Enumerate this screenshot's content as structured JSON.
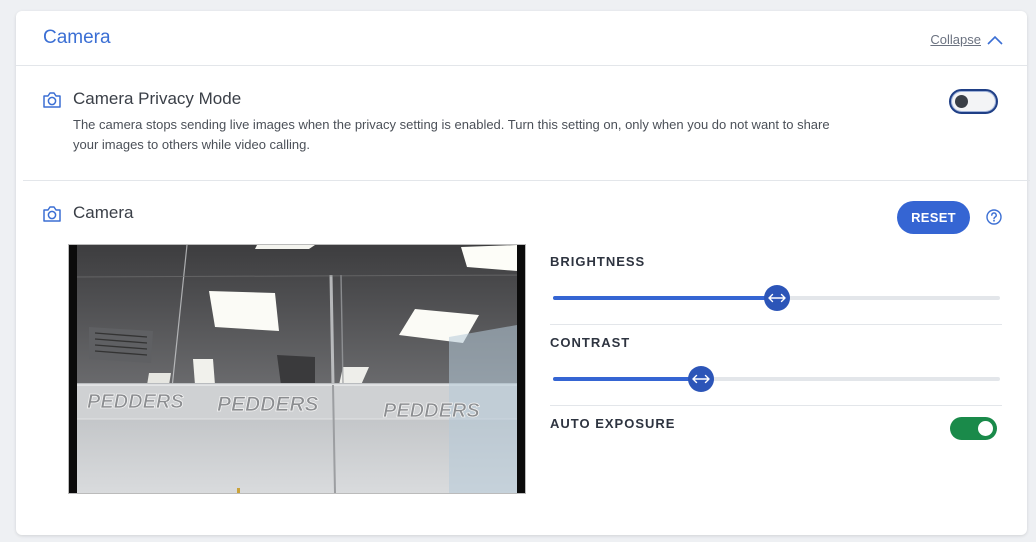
{
  "header": {
    "title": "Camera",
    "collapse_label": "Collapse"
  },
  "privacy": {
    "title": "Camera Privacy Mode",
    "description": "The camera stops sending live images when the privacy setting is enabled. Turn this setting on, only when you do not want to share your images to others while video calling.",
    "enabled": false
  },
  "camera": {
    "title": "Camera",
    "reset_label": "RESET",
    "help_icon": "question-circle-icon"
  },
  "controls": {
    "brightness": {
      "label": "BRIGHTNESS",
      "value": 0.5
    },
    "contrast": {
      "label": "CONTRAST",
      "value": 0.33
    },
    "auto_exposure": {
      "label": "AUTO EXPOSURE",
      "enabled": true
    }
  },
  "preview": {
    "glass_text": "PEDDERS"
  },
  "colors": {
    "accent": "#3565d3",
    "title": "#3b6fd4",
    "toggle_on": "#1a8a4a"
  }
}
